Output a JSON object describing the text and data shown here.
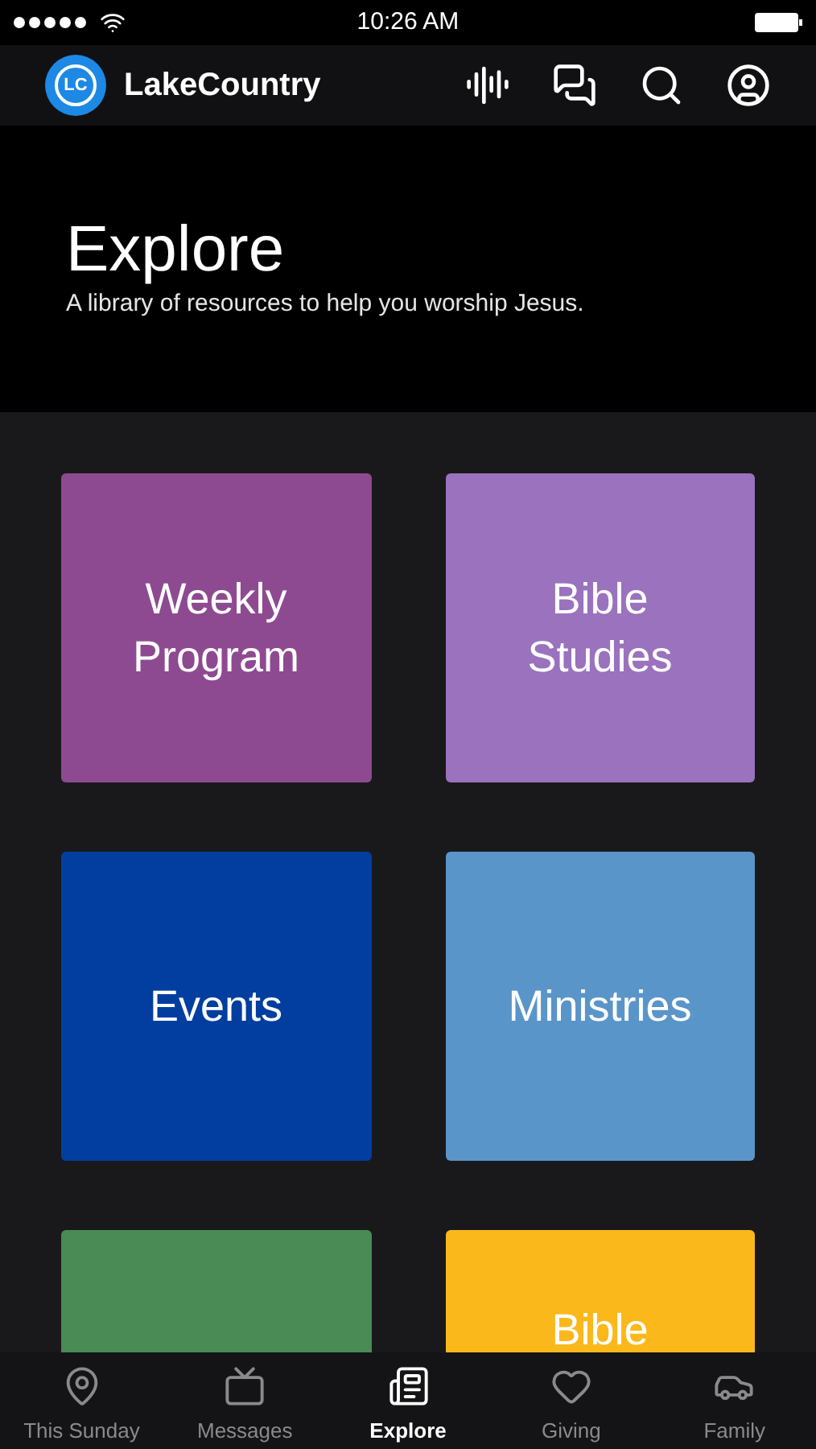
{
  "status_bar": {
    "time": "10:26 AM"
  },
  "header": {
    "logo_text": "LC",
    "title": "LakeCountry"
  },
  "hero": {
    "title": "Explore",
    "subtitle": "A library of resources to help you worship Jesus."
  },
  "tiles": [
    {
      "label": "Weekly Program",
      "color": "#8e4a91"
    },
    {
      "label": "Bible Studies",
      "color": "#9a72bd"
    },
    {
      "label": "Events",
      "color": "#023ea0"
    },
    {
      "label": "Ministries",
      "color": "#5a95c9"
    },
    {
      "color": "#4a8a55"
    },
    {
      "label": "Bible",
      "color": "#fbb81b"
    }
  ],
  "tab_bar": [
    {
      "label": "This Sunday",
      "selected": false
    },
    {
      "label": "Messages",
      "selected": false
    },
    {
      "label": "Explore",
      "selected": true
    },
    {
      "label": "Giving",
      "selected": false
    },
    {
      "label": "Family",
      "selected": false
    }
  ]
}
